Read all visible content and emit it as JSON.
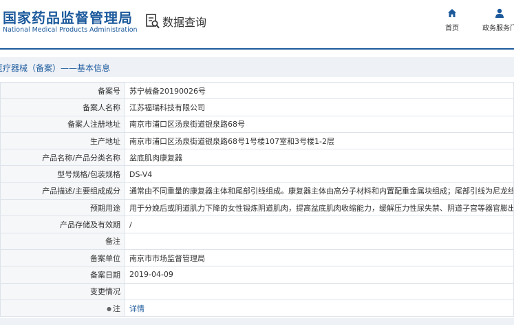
{
  "header": {
    "logo_cn": "国家药品监督管理局",
    "logo_en": "National Medical Products Administration",
    "query_title": "数据查询",
    "nav": [
      {
        "label": "首页",
        "icon": "home-icon"
      },
      {
        "label": "政务服务门",
        "icon": "user-icon"
      }
    ]
  },
  "breadcrumb": "医疗器械（备案）——基本信息",
  "rows": [
    {
      "label": "备案号",
      "value": "苏宁械备20190026号"
    },
    {
      "label": "备案人名称",
      "value": "江苏福瑞科技有限公司"
    },
    {
      "label": "备案人注册地址",
      "value": "南京市浦口区汤泉街道银泉路68号"
    },
    {
      "label": "生产地址",
      "value": "南京市浦口区汤泉街道银泉路68号1号楼107室和3号楼1-2层"
    },
    {
      "label": "产品名称/产品分类名称",
      "value": "盆底肌肉康复器"
    },
    {
      "label": "型号规格/包装规格",
      "value": "DS-V4"
    },
    {
      "label": "产品描述/主要组成成分",
      "value": "通常由不同重量的康复器主体和尾部引线组成。康复器主体由高分子材料和内置配重金属块组成；尾部引线为尼龙线。"
    },
    {
      "label": "预期用途",
      "value": "用于分娩后或阴道肌力下降的女性锻炼阴道肌肉，提高盆底肌肉收缩能力，缓解压力性尿失禁、阴道子宫等器官膨出或脱垂等。"
    },
    {
      "label": "产品存储及有效期",
      "value": "/"
    },
    {
      "label": "备注",
      "value": ""
    },
    {
      "label": "备案单位",
      "value": "南京市市场监督管理局"
    },
    {
      "label": "备案日期",
      "value": "2019-04-09"
    },
    {
      "label": "变更情况",
      "value": ""
    },
    {
      "label": "注",
      "value": "详情",
      "label_icon": "bullet-icon"
    }
  ],
  "colors": {
    "brand": "#1c5a9c",
    "crumb_bg": "#eef1f6",
    "label_bg": "#f6f7f9",
    "border": "#dde3ea"
  }
}
